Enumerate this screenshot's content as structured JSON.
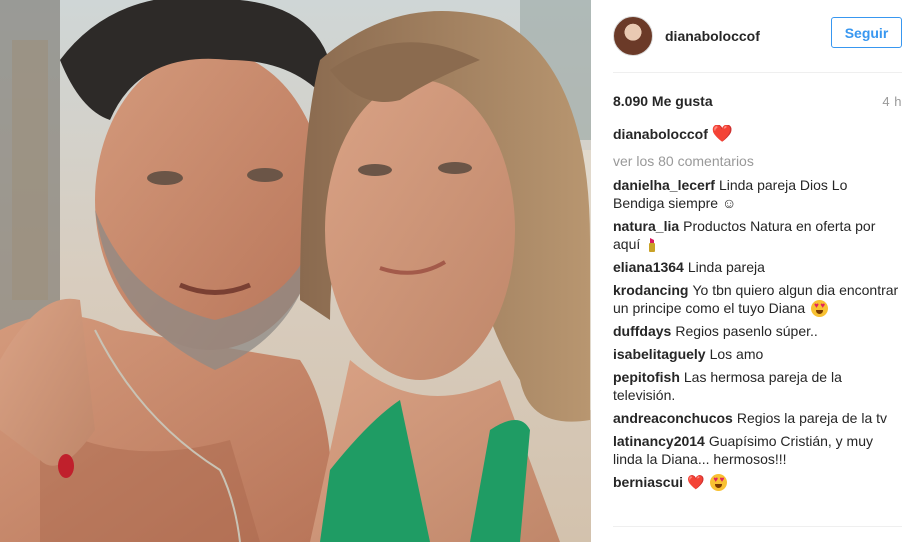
{
  "post": {
    "username": "dianaboloccof",
    "follow_label": "Seguir",
    "likes": "8.090 Me gusta",
    "time": "4 h",
    "caption_user": "dianaboloccof",
    "caption_text": "❤️",
    "view_all": "ver los 80 comentarios"
  },
  "comments": [
    {
      "user": "danielha_lecerf",
      "text": "Linda pareja Dios Lo Bendiga siempre ☺"
    },
    {
      "user": "natura_lia",
      "text": "Productos Natura en oferta por aquí",
      "emoji": "lipstick"
    },
    {
      "user": "eliana1364",
      "text": "Linda pareja"
    },
    {
      "user": "krodancing",
      "text": "Yo tbn quiero algun dia encontrar un principe como el tuyo Diana",
      "emoji": "heart-eyes"
    },
    {
      "user": "duffdays",
      "text": "Regios pasenlo súper.."
    },
    {
      "user": "isabelitaguely",
      "text": "Los amo"
    },
    {
      "user": "pepitofish",
      "text": "Las hermosa pareja de la televisión."
    },
    {
      "user": "andreaconchucos",
      "text": "Regios la pareja de la tv"
    },
    {
      "user": "latinancy2014",
      "text": "Guapísimo Cristián, y muy linda la Diana... hermosos!!!"
    },
    {
      "user": "berniascui",
      "text": "❤️",
      "emoji": "heart-eyes"
    }
  ],
  "colors": {
    "accent": "#3897f0",
    "heart": "#e31b23",
    "muted": "#999999",
    "divider": "#efefef"
  },
  "icons": [
    "heart-icon",
    "lipstick-icon",
    "heart-eyes-emoji-icon",
    "smile-icon"
  ]
}
